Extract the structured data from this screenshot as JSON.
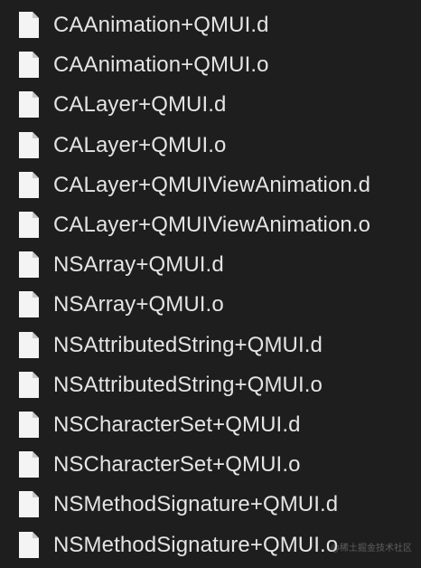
{
  "files": [
    {
      "name": "CAAnimation+QMUI.d",
      "icon": "document-icon"
    },
    {
      "name": "CAAnimation+QMUI.o",
      "icon": "document-icon"
    },
    {
      "name": "CALayer+QMUI.d",
      "icon": "document-icon"
    },
    {
      "name": "CALayer+QMUI.o",
      "icon": "document-icon"
    },
    {
      "name": "CALayer+QMUIViewAnimation.d",
      "icon": "document-icon"
    },
    {
      "name": "CALayer+QMUIViewAnimation.o",
      "icon": "document-icon"
    },
    {
      "name": "NSArray+QMUI.d",
      "icon": "document-icon"
    },
    {
      "name": "NSArray+QMUI.o",
      "icon": "document-icon"
    },
    {
      "name": "NSAttributedString+QMUI.d",
      "icon": "document-icon"
    },
    {
      "name": "NSAttributedString+QMUI.o",
      "icon": "document-icon"
    },
    {
      "name": "NSCharacterSet+QMUI.d",
      "icon": "document-icon"
    },
    {
      "name": "NSCharacterSet+QMUI.o",
      "icon": "document-icon"
    },
    {
      "name": "NSMethodSignature+QMUI.d",
      "icon": "document-icon"
    },
    {
      "name": "NSMethodSignature+QMUI.o",
      "icon": "document-icon"
    }
  ],
  "watermark": "@稀土掘金技术社区",
  "colors": {
    "background": "#1e1e1e",
    "text": "#e4e4e4",
    "icon_fill": "#f4f4f4",
    "icon_fold": "#c9c9c9"
  }
}
